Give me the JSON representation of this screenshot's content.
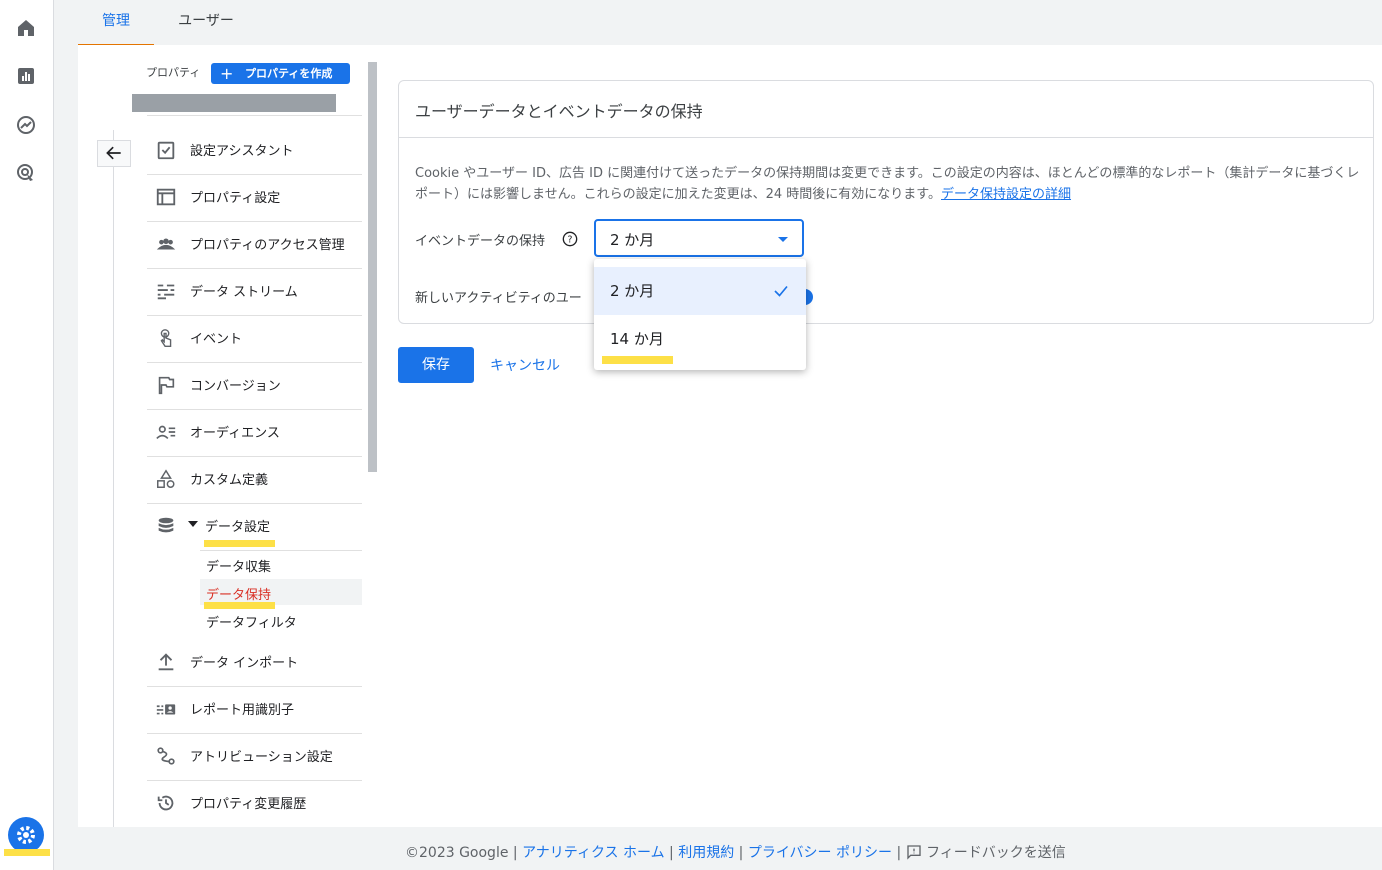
{
  "tabs": [
    "管理",
    "ユーザー"
  ],
  "property": {
    "label": "プロパティ",
    "create_button": "プロパティを作成"
  },
  "nav": {
    "items": [
      {
        "label": "設定アシスタント",
        "icon": "checklist-icon"
      },
      {
        "label": "プロパティ設定",
        "icon": "layout-icon"
      },
      {
        "label": "プロパティのアクセス管理",
        "icon": "people-icon"
      },
      {
        "label": "データ ストリーム",
        "icon": "streams-icon"
      },
      {
        "label": "イベント",
        "icon": "touch-icon"
      },
      {
        "label": "コンバージョン",
        "icon": "flag-icon"
      },
      {
        "label": "オーディエンス",
        "icon": "audience-icon"
      },
      {
        "label": "カスタム定義",
        "icon": "shapes-icon"
      },
      {
        "label": "データ設定",
        "icon": "database-icon"
      }
    ],
    "sub_items": [
      "データ収集",
      "データ保持",
      "データフィルタ"
    ],
    "items_after": [
      {
        "label": "データ インポート",
        "icon": "upload-icon"
      },
      {
        "label": "レポート用識別子",
        "icon": "identity-icon"
      },
      {
        "label": "アトリビューション設定",
        "icon": "attribution-icon"
      },
      {
        "label": "プロパティ変更履歴",
        "icon": "history-icon"
      }
    ]
  },
  "card": {
    "title": "ユーザーデータとイベントデータの保持",
    "description": "Cookie やユーザー ID、広告 ID に関連付けて送ったデータの保持期間は変更できます。この設定の内容は、ほとんどの標準的なレポート（集計データに基づくレポート）には影響しません。これらの設定に加えた変更は、24 時間後に有効になります。",
    "link": "データ保持設定の詳細",
    "event_label": "イベントデータの保持",
    "reset_label": "新しいアクティビティのユー",
    "select_value": "2 か月",
    "options": [
      "2 か月",
      "14 か月"
    ]
  },
  "actions": {
    "save": "保存",
    "cancel": "キャンセル"
  },
  "footer": {
    "copyright": "©2023 Google",
    "links": [
      "アナリティクス ホーム",
      "利用規約",
      "プライバシー ポリシー"
    ],
    "feedback": "フィードバックを送信"
  },
  "colors": {
    "accent": "#1a73e8",
    "highlight": "#fde047",
    "active_red": "#d93025",
    "tab_underline": "#e37400"
  }
}
